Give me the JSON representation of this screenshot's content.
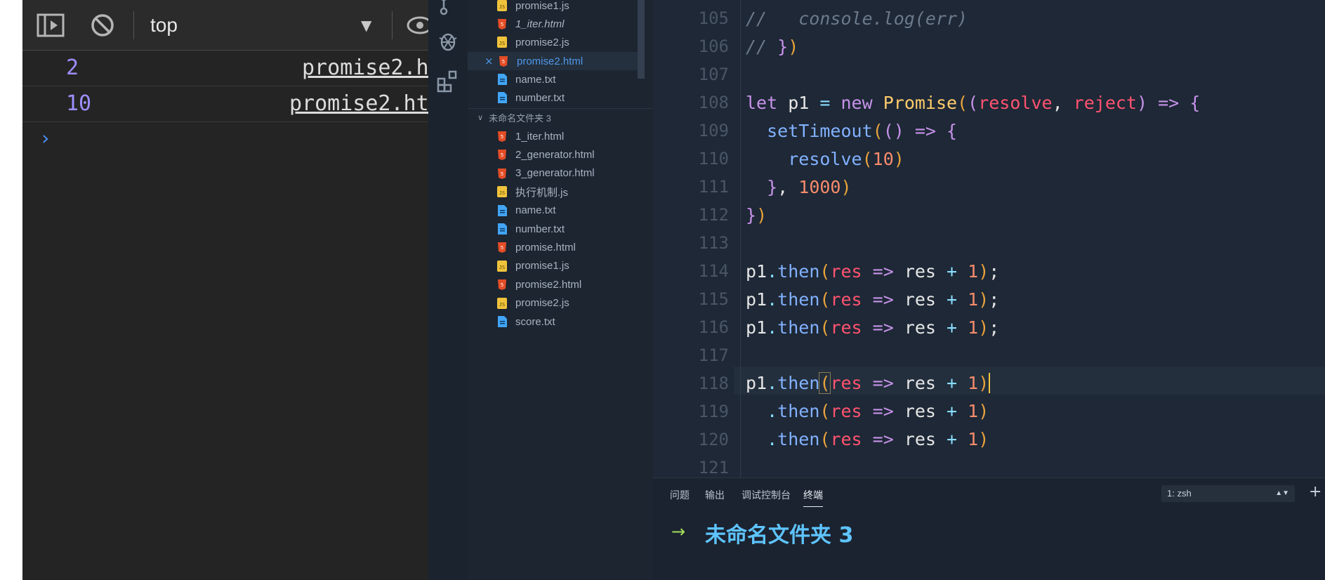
{
  "console": {
    "context": "top",
    "logs": [
      {
        "value": "2",
        "source": "promise2.h"
      },
      {
        "value": "10",
        "source": "promise2.ht"
      }
    ],
    "prompt": "›"
  },
  "explorer": {
    "top_items": [
      {
        "name": "promise1.js",
        "type": "js"
      },
      {
        "name": "1_iter.html",
        "type": "html"
      },
      {
        "name": "promise2.js",
        "type": "js"
      },
      {
        "name": "promise2.html",
        "type": "html"
      },
      {
        "name": "name.txt",
        "type": "txt"
      },
      {
        "name": "number.txt",
        "type": "txt"
      }
    ],
    "folder": "未命名文件夹 3",
    "folder_items": [
      {
        "name": "1_iter.html",
        "type": "html"
      },
      {
        "name": "2_generator.html",
        "type": "html"
      },
      {
        "name": "3_generator.html",
        "type": "html"
      },
      {
        "name": "执行机制.js",
        "type": "js"
      },
      {
        "name": "name.txt",
        "type": "txt"
      },
      {
        "name": "number.txt",
        "type": "txt"
      },
      {
        "name": "promise.html",
        "type": "html"
      },
      {
        "name": "promise1.js",
        "type": "js"
      },
      {
        "name": "promise2.html",
        "type": "html"
      },
      {
        "name": "promise2.js",
        "type": "js"
      },
      {
        "name": "score.txt",
        "type": "txt"
      }
    ],
    "close_mark": "×"
  },
  "editor": {
    "line_numbers": [
      "105",
      "106",
      "107",
      "108",
      "109",
      "110",
      "111",
      "112",
      "113",
      "114",
      "115",
      "116",
      "117",
      "118",
      "119",
      "120",
      "121"
    ]
  },
  "panel": {
    "tabs": [
      "问题",
      "输出",
      "调试控制台",
      "终端"
    ],
    "shell": "1: zsh",
    "add": "+",
    "prompt_arrow": "→",
    "directory": "未命名文件夹 3"
  },
  "colors": {
    "js": "#f0c33c",
    "html": "#e44d26",
    "txt": "#42a5f5"
  }
}
